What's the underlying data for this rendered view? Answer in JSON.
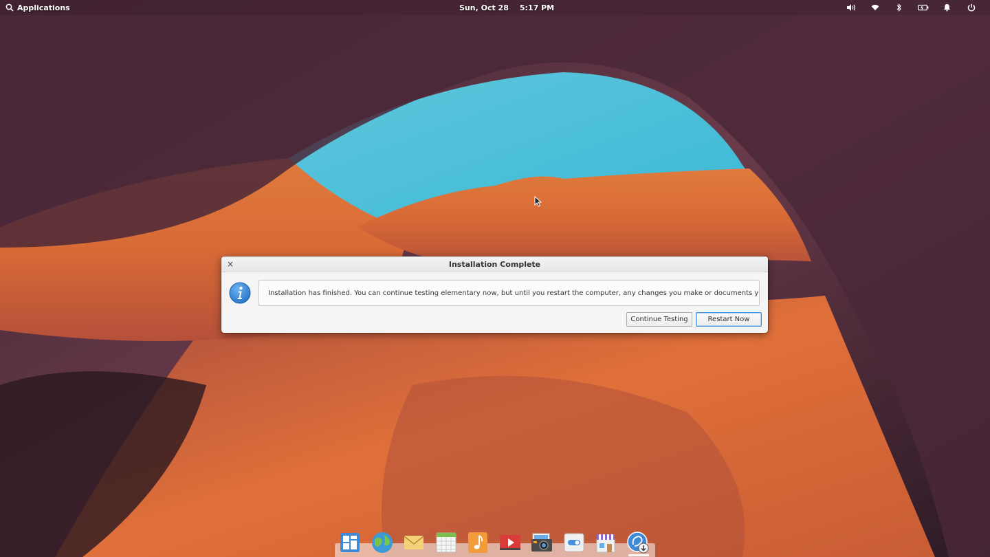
{
  "panel": {
    "applications_label": "Applications",
    "date": "Sun, Oct 28",
    "time": "5:17 PM",
    "indicators": [
      "volume-icon",
      "wifi-icon",
      "bluetooth-icon",
      "battery-icon",
      "notifications-icon",
      "power-icon"
    ]
  },
  "dialog": {
    "title": "Installation Complete",
    "close_glyph": "×",
    "message": "Installation has finished.  You can continue testing elementary now, but until you restart the computer, any changes you make or documents you save will not be preserved.",
    "continue_label": "Continue Testing",
    "restart_label": "Restart Now",
    "accent_color": "#3d8de0"
  },
  "dock": {
    "items": [
      "multitasking-view",
      "web-browser",
      "mail",
      "calendar",
      "music",
      "videos",
      "photos",
      "system-settings",
      "appcenter",
      "installer"
    ]
  }
}
